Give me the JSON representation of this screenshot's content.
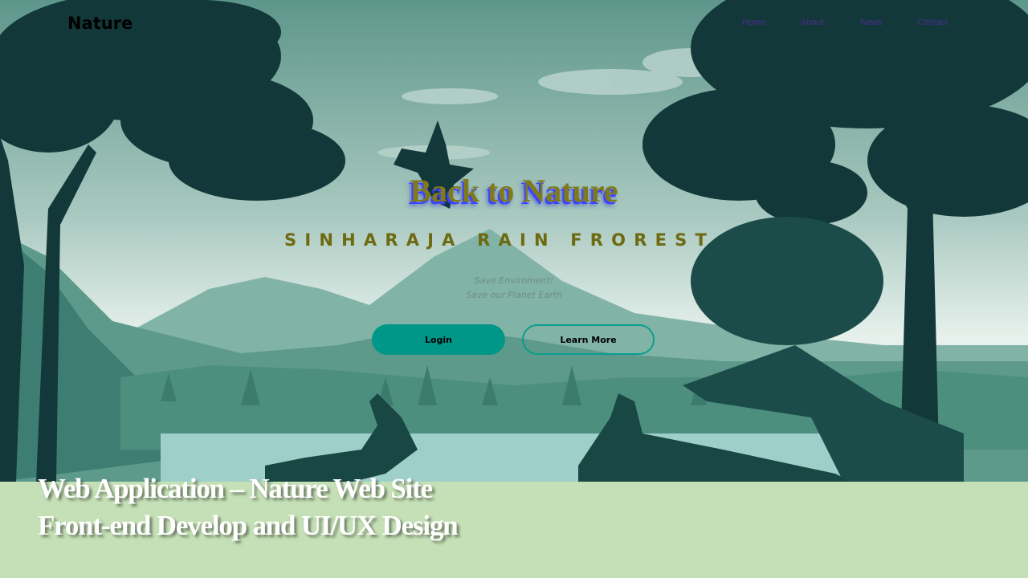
{
  "site": {
    "logo": "Nature",
    "nav": [
      {
        "label": "Home"
      },
      {
        "label": "About"
      },
      {
        "label": "News"
      },
      {
        "label": "Contact"
      }
    ]
  },
  "hero": {
    "title": "Back to Nature",
    "subtitle": "SINHARAJA RAIN FROREST",
    "tagline_1": "Save Enviroment!",
    "tagline_2": "Save our Planet Earth",
    "login_label": "Login",
    "learn_more_label": "Learn More"
  },
  "caption": {
    "line_1": "Web Application – Nature Web Site",
    "line_2": "Front-end Develop and UI/UX Design"
  },
  "colors": {
    "slide_background": "#c5e0b6",
    "sky_top": "#5e968b",
    "sky_bottom": "#e7f1ec",
    "tree_silhouette": "#12383a",
    "login_button": "#009688",
    "title_text": "#807a1c"
  }
}
